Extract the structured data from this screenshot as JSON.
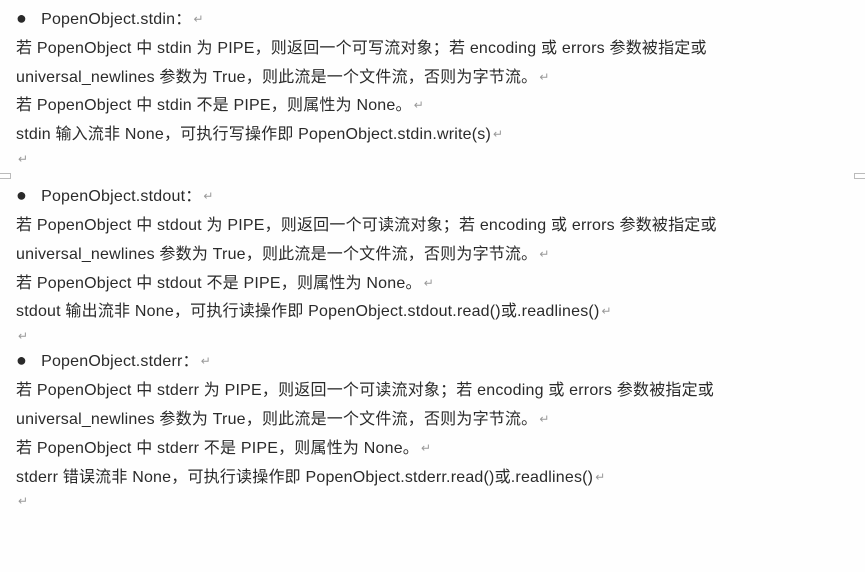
{
  "sections": [
    {
      "title": "PopenObject.stdin：",
      "lines": [
        "若 PopenObject 中 stdin 为 PIPE，则返回一个可写流对象；若 encoding 或 errors 参数被指定或 universal_newlines 参数为 True，则此流是一个文件流，否则为字节流。",
        "若 PopenObject 中 stdin 不是 PIPE，则属性为 None。",
        "stdin 输入流非 None，可执行写操作即 PopenObject.stdin.write(s)"
      ]
    },
    {
      "title": "PopenObject.stdout：",
      "lines": [
        "若 PopenObject 中 stdout 为 PIPE，则返回一个可读流对象；若 encoding 或 errors 参数被指定或 universal_newlines 参数为 True，则此流是一个文件流，否则为字节流。",
        "若 PopenObject 中 stdout 不是 PIPE，则属性为 None。",
        "stdout 输出流非 None，可执行读操作即 PopenObject.stdout.read()或.readlines()"
      ]
    },
    {
      "title": "PopenObject.stderr：",
      "lines": [
        "若 PopenObject 中 stderr 为 PIPE，则返回一个可读流对象；若 encoding 或 errors 参数被指定或 universal_newlines 参数为 True，则此流是一个文件流，否则为字节流。",
        "若 PopenObject 中 stderr 不是 PIPE，则属性为 None。",
        "stderr 错误流非 None，可执行读操作即 PopenObject.stderr.read()或.readlines()"
      ]
    }
  ],
  "para_mark": "↵"
}
